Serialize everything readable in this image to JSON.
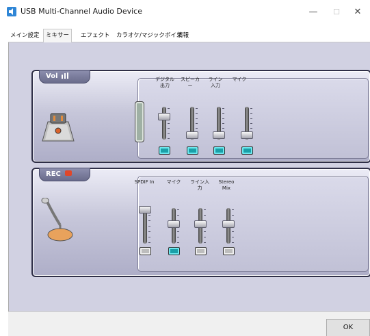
{
  "window": {
    "title": "USB Multi-Channel Audio Device",
    "controls": {
      "minimize": "—",
      "maximize": "☐",
      "close": "✕"
    }
  },
  "tabs": [
    {
      "label": "メイン設定",
      "active": false
    },
    {
      "label": "ミキサー",
      "active": true
    },
    {
      "label": "エフェクト",
      "active": false
    },
    {
      "label": "カラオケ/マジックボイス",
      "active": false
    },
    {
      "label": "情報",
      "active": false
    }
  ],
  "playback": {
    "header": "Vol",
    "channels": [
      {
        "label": "デジタル出力",
        "level": 0.72,
        "muted": false
      },
      {
        "label": "スピーカー",
        "level": 0.08,
        "muted": false
      },
      {
        "label": "ライン入力",
        "level": 0.08,
        "muted": false
      },
      {
        "label": "マイク",
        "level": 0.08,
        "muted": false
      }
    ]
  },
  "record": {
    "header": "REC",
    "channels": [
      {
        "label": "SPDIF In",
        "level": 1.0,
        "muted": true
      },
      {
        "label": "マイク",
        "level": 0.55,
        "muted": false
      },
      {
        "label": "ライン入力",
        "level": 0.55,
        "muted": true
      },
      {
        "label": "Stereo Mix",
        "level": 0.55,
        "muted": true
      }
    ]
  },
  "footer": {
    "ok_label": "OK"
  },
  "colors": {
    "accent": "#1aa0a8",
    "panel": "#c7c7da",
    "frame": "#2e2e46"
  }
}
